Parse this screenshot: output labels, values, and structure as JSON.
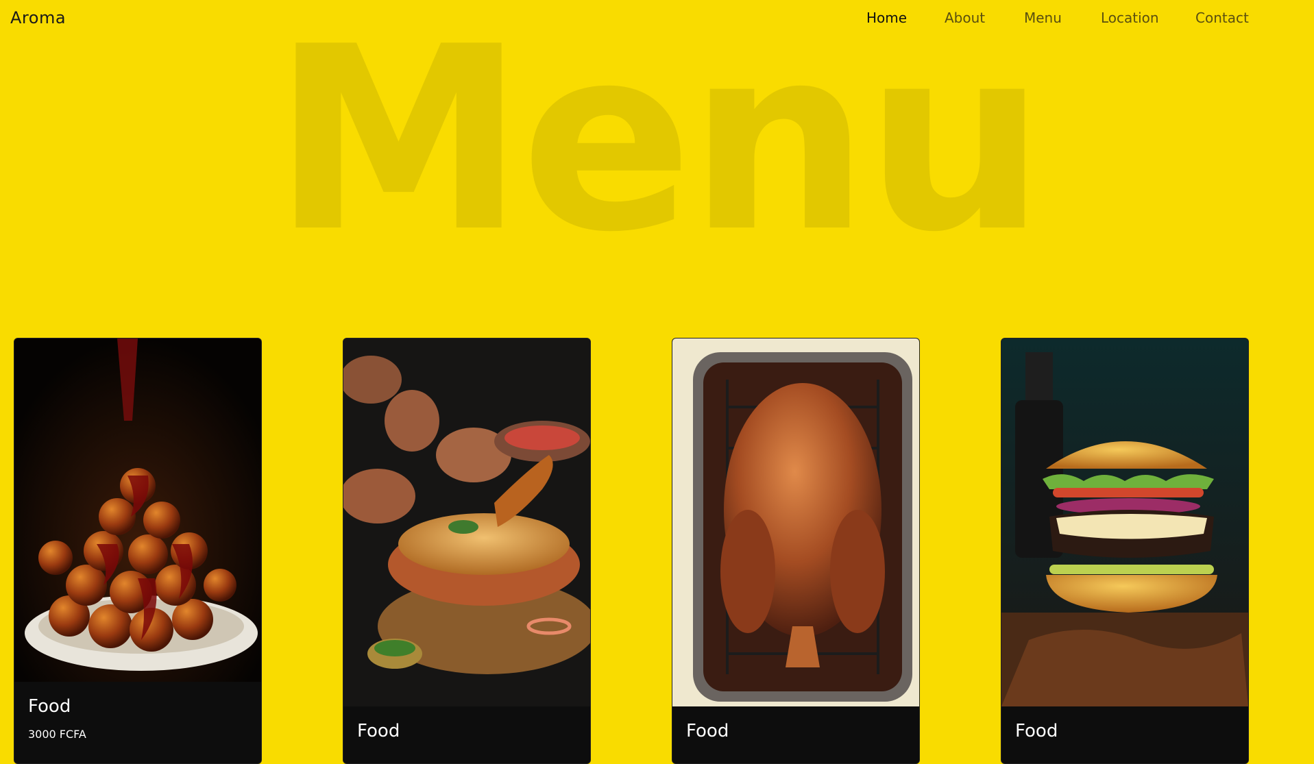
{
  "brand": "Aroma",
  "nav": {
    "items": [
      {
        "label": "Home",
        "active": true
      },
      {
        "label": "About"
      },
      {
        "label": "Menu"
      },
      {
        "label": "Location"
      },
      {
        "label": "Contact"
      }
    ]
  },
  "hero": {
    "title": "Menu"
  },
  "colors": {
    "background": "#f9dc00",
    "hero_text": "#e2c800",
    "card": "#0d0d0d"
  },
  "cards": [
    {
      "title": "Food",
      "price": "3000 FCFA",
      "image": "glazed-dessert-balls-photo"
    },
    {
      "title": "Food",
      "image": "biryani-chicken-photo"
    },
    {
      "title": "Food",
      "image": "roast-turkey-photo"
    },
    {
      "title": "Food",
      "image": "bacon-cheeseburger-photo"
    }
  ]
}
